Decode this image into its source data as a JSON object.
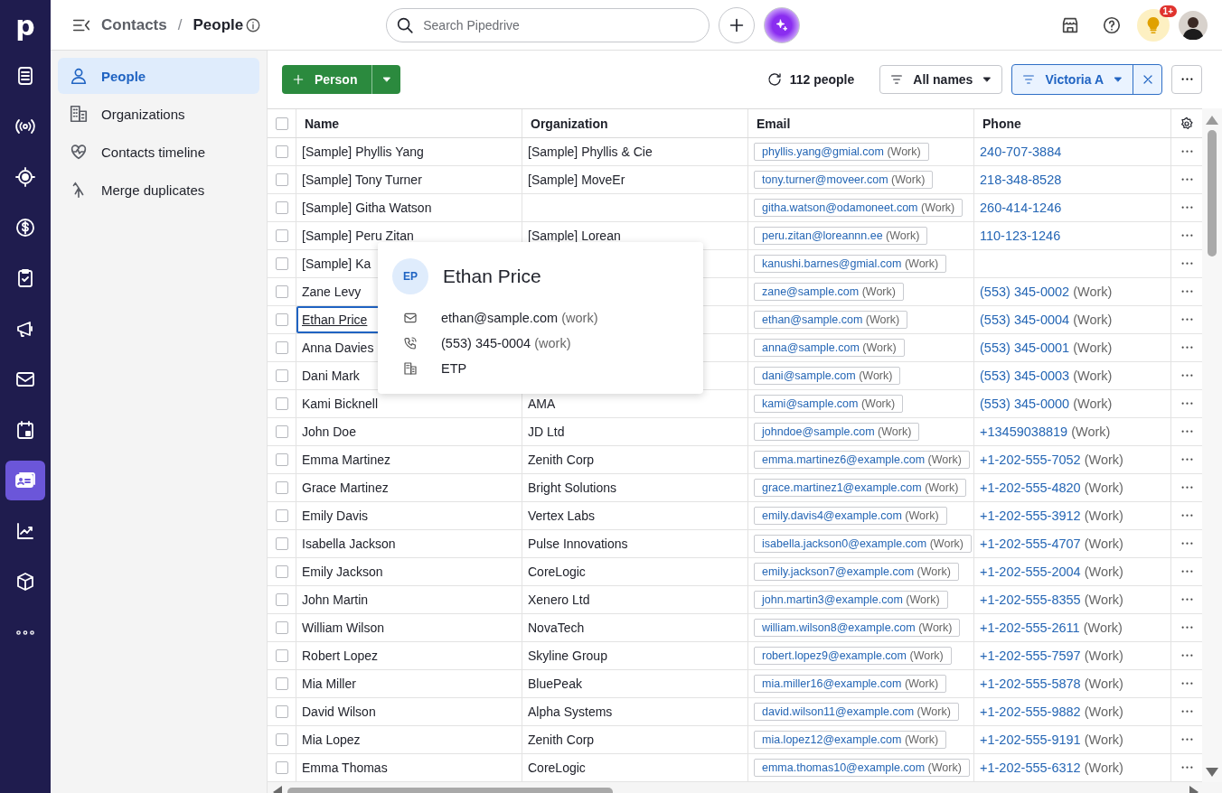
{
  "rail": {
    "logo": "p",
    "items": [
      {
        "selected": false
      },
      {
        "selected": false
      },
      {
        "selected": false
      },
      {
        "selected": false
      },
      {
        "selected": false
      },
      {
        "selected": false
      },
      {
        "selected": false
      },
      {
        "selected": false
      },
      {
        "selected": true
      },
      {
        "selected": false
      },
      {
        "selected": false
      },
      {
        "selected": false
      }
    ]
  },
  "header": {
    "breadcrumb": "Contacts",
    "separator": "/",
    "title": "People",
    "search": {
      "placeholder": "Search Pipedrive"
    },
    "tips_badge": "1+"
  },
  "sidebar": {
    "items": [
      {
        "label": "People",
        "selected": true
      },
      {
        "label": "Organizations",
        "selected": false
      },
      {
        "label": "Contacts timeline",
        "selected": false
      },
      {
        "label": "Merge duplicates",
        "selected": false
      }
    ]
  },
  "toolbar": {
    "add_button": "Person",
    "count": "112 people",
    "filter": "All names",
    "owner_filter": "Victoria A"
  },
  "table": {
    "all_checked": false,
    "columns": [
      "Name",
      "Organization",
      "Email",
      "Phone"
    ],
    "rows": [
      {
        "name": "[Sample] Phyllis Yang",
        "organization": "[Sample] Phyllis & Cie",
        "email": "phyllis.yang@gmial.com",
        "email_label": "(Work)",
        "phone": "240-707-3884",
        "checked": false,
        "focused": false
      },
      {
        "name": "[Sample] Tony Turner",
        "organization": "[Sample] MoveEr",
        "email": "tony.turner@moveer.com",
        "email_label": "(Work)",
        "phone": "218-348-8528",
        "checked": false,
        "focused": false
      },
      {
        "name": "[Sample] Githa Watson",
        "email": "githa.watson@odamoneet.com",
        "email_label": "(Work)",
        "phone": "260-414-1246",
        "checked": false,
        "focused": false
      },
      {
        "name": "[Sample] Peru Zitan",
        "organization": "[Sample] Lorean",
        "email": "peru.zitan@loreannn.ee",
        "email_label": "(Work)",
        "phone": "110-123-1246",
        "checked": false,
        "focused": false
      },
      {
        "name": "[Sample] Ka",
        "email": "kanushi.barnes@gmial.com",
        "email_label": "(Work)",
        "checked": false,
        "focused": false
      },
      {
        "name": "Zane Levy",
        "email": "zane@sample.com",
        "email_label": "(Work)",
        "phone": "(553) 345-0002",
        "phone_label": "(Work)",
        "checked": false,
        "focused": false
      },
      {
        "name": "Ethan Price",
        "email": "ethan@sample.com",
        "email_label": "(Work)",
        "phone": "(553) 345-0004",
        "phone_label": "(Work)",
        "checked": false,
        "focused": true
      },
      {
        "name": "Anna Davies",
        "email": "anna@sample.com",
        "email_label": "(Work)",
        "phone": "(553) 345-0001",
        "phone_label": "(Work)",
        "checked": false,
        "focused": false
      },
      {
        "name": "Dani Mark",
        "email": "dani@sample.com",
        "email_label": "(Work)",
        "phone": "(553) 345-0003",
        "phone_label": "(Work)",
        "checked": false,
        "focused": false
      },
      {
        "name": "Kami Bicknell",
        "organization": "AMA",
        "email": "kami@sample.com",
        "email_label": "(Work)",
        "phone": "(553) 345-0000",
        "phone_label": "(Work)",
        "checked": false,
        "focused": false
      },
      {
        "name": "John Doe",
        "organization": "JD Ltd",
        "email": "johndoe@sample.com",
        "email_label": "(Work)",
        "phone": "+13459038819",
        "phone_label": "(Work)",
        "checked": false,
        "focused": false
      },
      {
        "name": "Emma Martinez",
        "organization": "Zenith Corp",
        "email": "emma.martinez6@example.com",
        "email_label": "(Work)",
        "phone": "+1-202-555-7052",
        "phone_label": "(Work)",
        "checked": false,
        "focused": false
      },
      {
        "name": "Grace Martinez",
        "organization": "Bright Solutions",
        "email": "grace.martinez1@example.com",
        "email_label": "(Work)",
        "phone": "+1-202-555-4820",
        "phone_label": "(Work)",
        "checked": false,
        "focused": false
      },
      {
        "name": "Emily Davis",
        "organization": "Vertex Labs",
        "email": "emily.davis4@example.com",
        "email_label": "(Work)",
        "phone": "+1-202-555-3912",
        "phone_label": "(Work)",
        "checked": false,
        "focused": false
      },
      {
        "name": "Isabella Jackson",
        "organization": "Pulse Innovations",
        "email": "isabella.jackson0@example.com",
        "email_label": "(Work)",
        "phone": "+1-202-555-4707",
        "phone_label": "(Work)",
        "checked": false,
        "focused": false
      },
      {
        "name": "Emily Jackson",
        "organization": "CoreLogic",
        "email": "emily.jackson7@example.com",
        "email_label": "(Work)",
        "phone": "+1-202-555-2004",
        "phone_label": "(Work)",
        "checked": false,
        "focused": false
      },
      {
        "name": "John Martin",
        "organization": "Xenero Ltd",
        "email": "john.martin3@example.com",
        "email_label": "(Work)",
        "phone": "+1-202-555-8355",
        "phone_label": "(Work)",
        "checked": false,
        "focused": false
      },
      {
        "name": "William Wilson",
        "organization": "NovaTech",
        "email": "william.wilson8@example.com",
        "email_label": "(Work)",
        "phone": "+1-202-555-2611",
        "phone_label": "(Work)",
        "checked": false,
        "focused": false
      },
      {
        "name": "Robert Lopez",
        "organization": "Skyline Group",
        "email": "robert.lopez9@example.com",
        "email_label": "(Work)",
        "phone": "+1-202-555-7597",
        "phone_label": "(Work)",
        "checked": false,
        "focused": false
      },
      {
        "name": "Mia Miller",
        "organization": "BluePeak",
        "email": "mia.miller16@example.com",
        "email_label": "(Work)",
        "phone": "+1-202-555-5878",
        "phone_label": "(Work)",
        "checked": false,
        "focused": false
      },
      {
        "name": "David Wilson",
        "organization": "Alpha Systems",
        "email": "david.wilson11@example.com",
        "email_label": "(Work)",
        "phone": "+1-202-555-9882",
        "phone_label": "(Work)",
        "checked": false,
        "focused": false
      },
      {
        "name": "Mia Lopez",
        "organization": "Zenith Corp",
        "email": "mia.lopez12@example.com",
        "email_label": "(Work)",
        "phone": "+1-202-555-9191",
        "phone_label": "(Work)",
        "checked": false,
        "focused": false
      },
      {
        "name": "Emma Thomas",
        "organization": "CoreLogic",
        "email": "emma.thomas10@example.com",
        "email_label": "(Work)",
        "phone": "+1-202-555-6312",
        "phone_label": "(Work)",
        "checked": false,
        "focused": false
      }
    ]
  },
  "popup": {
    "initials": "EP",
    "name": "Ethan Price",
    "email": "ethan@sample.com",
    "email_label": "(work)",
    "phone": "(553) 345-0004",
    "phone_label": "(work)",
    "organization": "ETP"
  }
}
